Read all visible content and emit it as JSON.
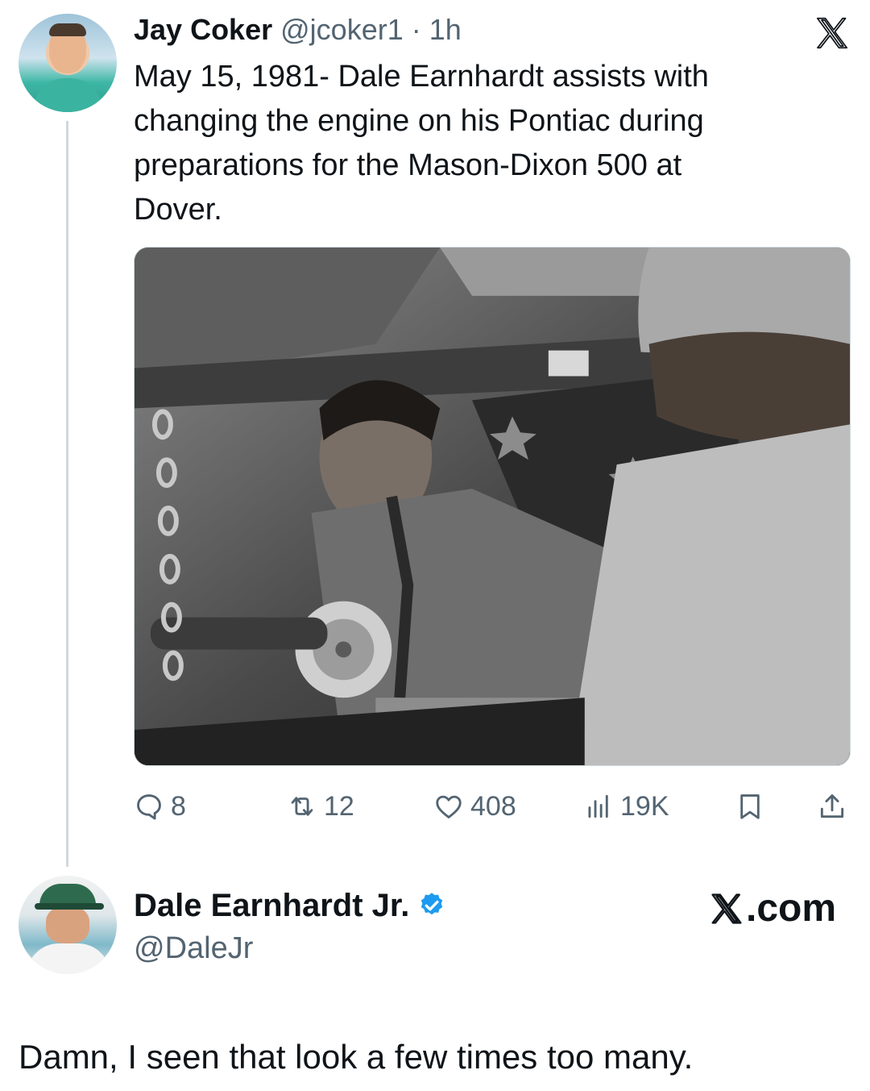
{
  "tweet": {
    "author_name": "Jay Coker",
    "author_handle": "@jcoker1",
    "separator": "·",
    "time": "1h",
    "text_lines": [
      "May 15, 1981- Dale Earnhardt assists with",
      "changing the engine on his Pontiac during",
      "preparations for the Mason-Dixon 500 at",
      "Dover."
    ],
    "actions": {
      "replies": "8",
      "reposts": "12",
      "likes": "408",
      "views": "19K"
    }
  },
  "reply_tweet": {
    "author_name": "Dale Earnhardt Jr.",
    "author_handle": "@DaleJr",
    "brand": ".com",
    "text": "Damn, I seen that look a few times too many."
  },
  "icons": {
    "x_logo": "x-logo-icon",
    "reply": "speech-bubble-icon",
    "repost": "repost-arrows-icon",
    "like": "heart-icon",
    "views": "bar-chart-icon",
    "bookmark": "bookmark-icon",
    "share": "share-upload-icon",
    "verified": "verified-badge-icon"
  },
  "colors": {
    "text": "#0f1419",
    "secondary": "#536471",
    "verified_blue": "#1d9bf0",
    "thread_line": "#cfd9de"
  }
}
